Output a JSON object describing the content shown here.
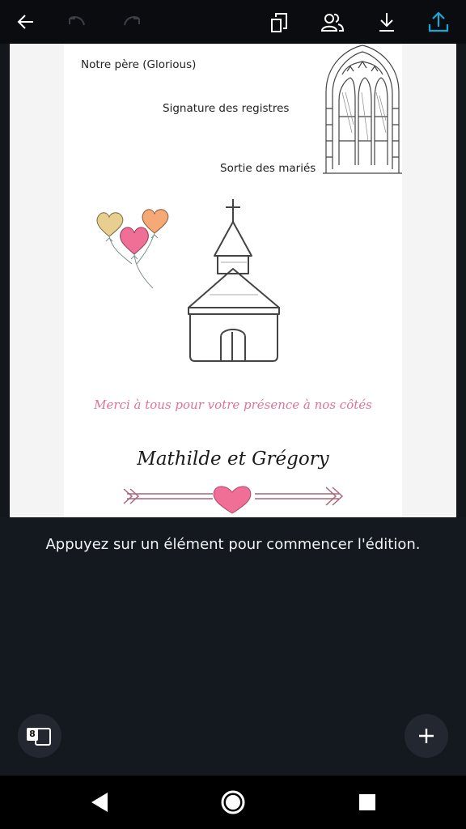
{
  "toolbar": {
    "back_icon": "arrow-left-icon",
    "undo_icon": "undo-icon",
    "redo_icon": "redo-icon",
    "resize_icon": "resize-copy-icon",
    "share_people_icon": "people-icon",
    "download_icon": "download-icon",
    "share_icon": "share-upload-icon"
  },
  "document": {
    "line1": "Notre père (Glorious)",
    "line2": "Signature des registres",
    "line3": "Sortie des mariés",
    "thanks": "Merci à tous pour votre présence à nos côtés",
    "names": "Mathilde et Grégory"
  },
  "hint": "Appuyez sur un élément pour commencer l'édition.",
  "pages": {
    "count": "8"
  },
  "colors": {
    "accent": "#19a8d6",
    "pink": "#e2719a",
    "background": "#141920"
  }
}
